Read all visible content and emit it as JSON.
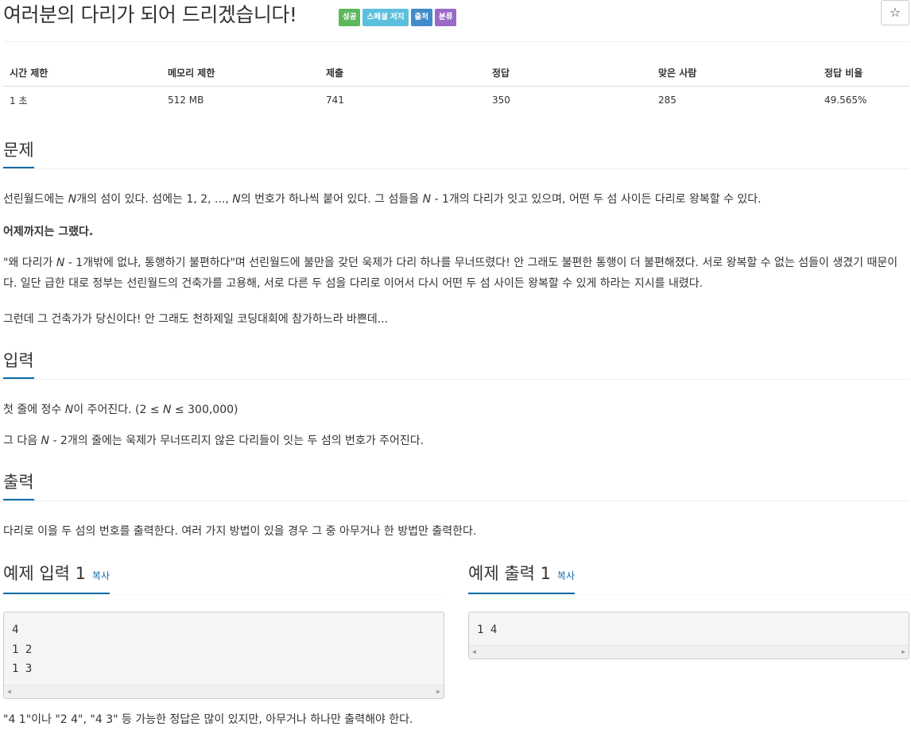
{
  "title": "여러분의 다리가 되어 드리겠습니다!",
  "badges": [
    "성공",
    "스페셜 저지",
    "출처",
    "분류"
  ],
  "star_icon": "star-outline-icon",
  "stats": {
    "headers": [
      "시간 제한",
      "메모리 제한",
      "제출",
      "정답",
      "맞은 사람",
      "정답 비율"
    ],
    "values": [
      "1 초",
      "512 MB",
      "741",
      "350",
      "285",
      "49.565%"
    ]
  },
  "problem": {
    "heading": "문제",
    "p1_a": "선린월드에는 ",
    "p1_var": "N",
    "p1_b": "개의 섬이 있다. 섬에는 1, 2, ..., ",
    "p1_var2": "N",
    "p1_c": "의 번호가 하나씩 붙어 있다. 그 섬들을 ",
    "p1_var3": "N",
    "p1_d": " - 1개의 다리가 잇고 있으며, 어떤 두 섬 사이든 다리로 왕복할 수 있다.",
    "p2": "어제까지는 그랬다.",
    "p3_a": "\"왜 다리가 ",
    "p3_var": "N",
    "p3_b": " - 1개밖에 없냐, 통행하기 불편하다\"며 선린월드에 불만을 갖던 욱제가 다리 하나를 무너뜨렸다! 안 그래도 불편한 통행이 더 불편해졌다. 서로 왕복할 수 없는 섬들이 생겼기 때문이다. 일단 급한 대로 정부는 선린월드의 건축가를 고용해, 서로 다른 두 섬을 다리로 이어서 다시 어떤 두 섬 사이든 왕복할 수 있게 하라는 지시를 내렸다.",
    "p4": "그런데 그 건축가가 당신이다! 안 그래도 천하제일 코딩대회에 참가하느라 바쁜데..."
  },
  "input": {
    "heading": "입력",
    "p1_a": "첫 줄에 정수 ",
    "p1_var": "N",
    "p1_b": "이 주어진다. (2 ≤ ",
    "p1_var2": "N",
    "p1_c": " ≤ 300,000)",
    "p2_a": "그 다음 ",
    "p2_var": "N",
    "p2_b": " - 2개의 줄에는 욱제가 무너뜨리지 않은 다리들이 잇는 두 섬의 번호가 주어진다."
  },
  "output": {
    "heading": "출력",
    "p1": "다리로 이을 두 섬의 번호를 출력한다. 여러 가지 방법이 있을 경우 그 중 아무거나 한 방법만 출력한다."
  },
  "samples": {
    "input_heading": "예제 입력 1",
    "output_heading": "예제 출력 1",
    "copy_label": "복사",
    "input_text": "4\n1 2\n1 3",
    "output_text": "1 4",
    "note": "\"4 1\"이나 \"2 4\", \"4 3\" 등 가능한 정답은 많이 있지만, 아무거나 하나만 출력해야 한다."
  }
}
